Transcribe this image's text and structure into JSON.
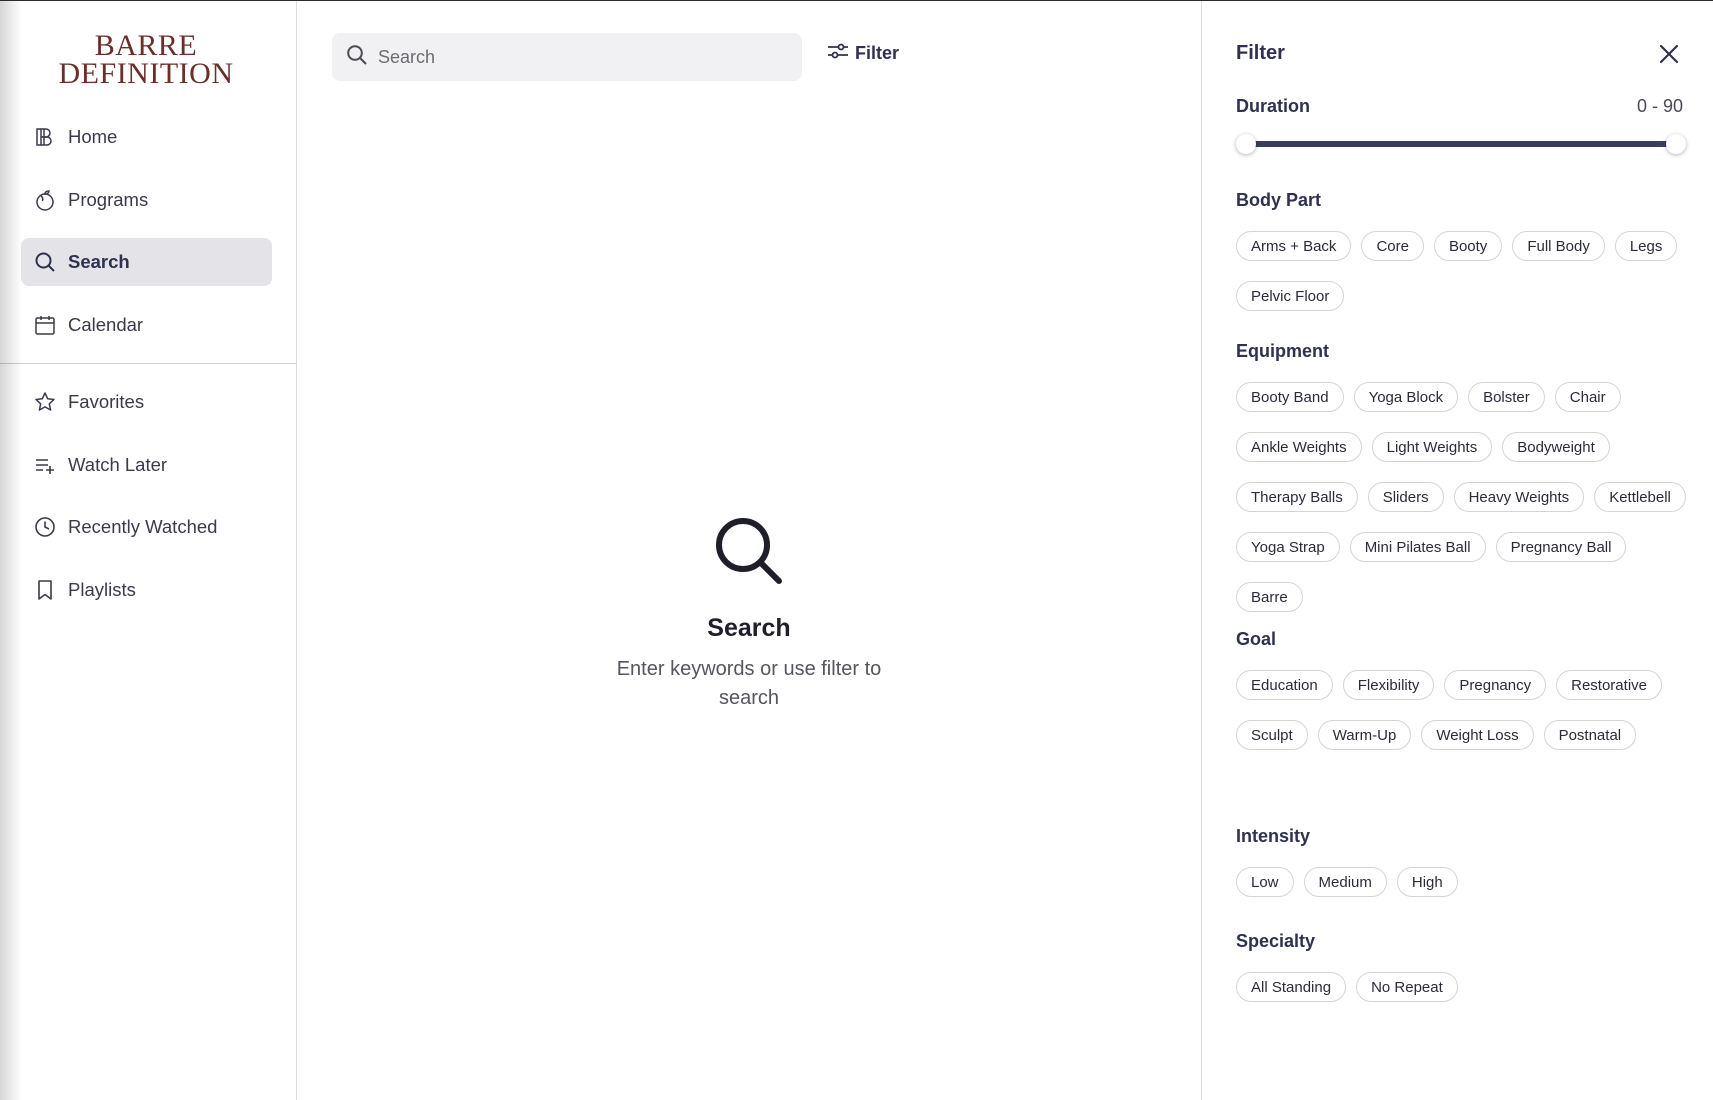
{
  "brand": {
    "line1": "BARRE",
    "line2": "DEFINITION"
  },
  "sidebar": {
    "primary": [
      {
        "label": "Home",
        "icon": "brand-b-icon",
        "active": false
      },
      {
        "label": "Programs",
        "icon": "peach-icon",
        "active": false
      },
      {
        "label": "Search",
        "icon": "search-icon",
        "active": true
      },
      {
        "label": "Calendar",
        "icon": "calendar-icon",
        "active": false
      }
    ],
    "secondary": [
      {
        "label": "Favorites",
        "icon": "star-icon"
      },
      {
        "label": "Watch Later",
        "icon": "playlist-add-icon"
      },
      {
        "label": "Recently Watched",
        "icon": "clock-icon"
      },
      {
        "label": "Playlists",
        "icon": "bookmark-icon"
      }
    ]
  },
  "search": {
    "placeholder": "Search",
    "value": ""
  },
  "filter_button": {
    "label": "Filter"
  },
  "empty_state": {
    "title": "Search",
    "description": "Enter keywords or use filter to search"
  },
  "panel": {
    "title": "Filter",
    "duration": {
      "label": "Duration",
      "value_text": "0 - 90",
      "min": 0,
      "max": 90,
      "low": 0,
      "high": 90
    },
    "sections": [
      {
        "title": "Body Part",
        "chips": [
          "Arms + Back",
          "Core",
          "Booty",
          "Full Body",
          "Legs",
          "Pelvic Floor"
        ]
      },
      {
        "title": "Equipment",
        "chips": [
          "Booty Band",
          "Yoga Block",
          "Bolster",
          "Chair",
          "Ankle Weights",
          "Light Weights",
          "Bodyweight",
          "Therapy Balls",
          "Sliders",
          "Heavy Weights",
          "Kettlebell",
          "Yoga Strap",
          "Mini Pilates Ball",
          "Pregnancy Ball",
          "Barre"
        ]
      },
      {
        "title": "Goal",
        "chips": [
          "Education",
          "Flexibility",
          "Pregnancy",
          "Restorative",
          "Sculpt",
          "Warm-Up",
          "Weight Loss",
          "Postnatal"
        ]
      },
      {
        "title": "Intensity",
        "chips": [
          "Low",
          "Medium",
          "High"
        ]
      },
      {
        "title": "Specialty",
        "chips": [
          "All Standing",
          "No Repeat"
        ]
      }
    ]
  },
  "colors": {
    "accent": "#2e3150",
    "brand": "#6b2f2a",
    "active_bg": "#e3e3e8",
    "track": "#3a3d5c"
  }
}
